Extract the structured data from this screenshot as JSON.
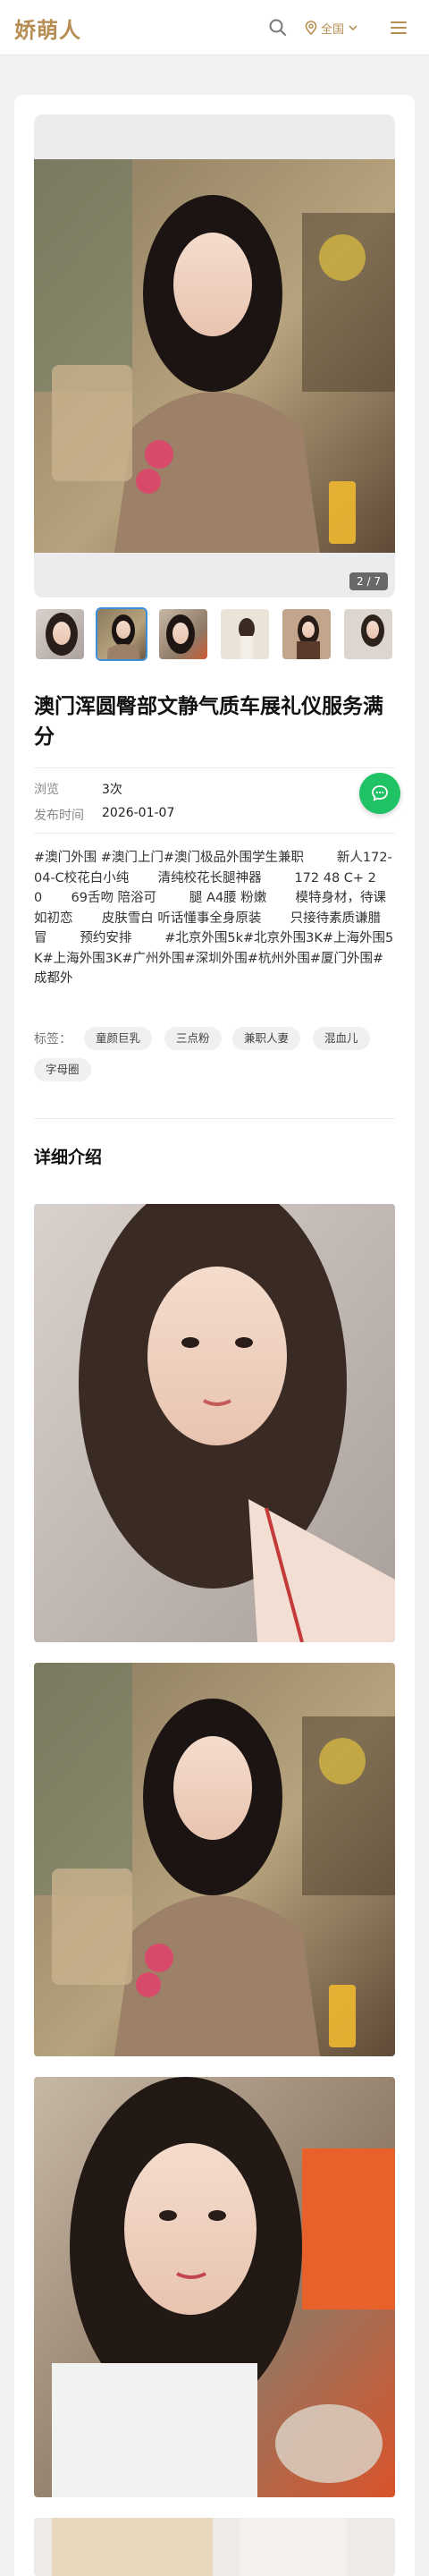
{
  "header": {
    "logo": "娇萌人",
    "region_label": "全国"
  },
  "gallery": {
    "counter": "2 / 7"
  },
  "post": {
    "title": "澳门浑圆臀部文静气质车展礼仪服务满分",
    "views_label": "浏览",
    "views_value": "3次",
    "date_label": "发布时间",
    "date_value": "2026-01-07",
    "description": "#澳门外围 #澳门上门#澳门极品外围学生兼职        新人172-04-C校花白小纯       清纯校花长腿神器        172 48 C+ 20       69舌吻 陪浴可        腿 A4腰 粉嫩       模特身材，待课如初恋       皮肤雪白 听话懂事全身原装       只接待素质谦腊冒        预约安排        #北京外围5k#北京外围3K#上海外围5K#上海外围3K#广州外围#深圳外围#杭州外围#厦门外围#成都外",
    "tags_label": "标签：",
    "tags": [
      "童颜巨乳",
      "三点粉",
      "兼职人妻",
      "混血儿",
      "字母圈"
    ]
  },
  "detail": {
    "section_title": "详细介绍"
  },
  "colors": {
    "brand": "#b68d52",
    "chat": "#1fc264",
    "thumb_active_border": "#3d8ed8"
  }
}
